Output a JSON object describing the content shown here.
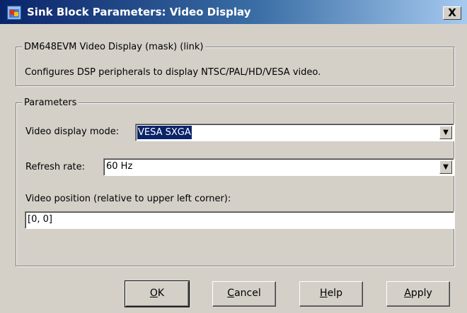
{
  "window": {
    "title": "Sink Block Parameters: Video Display",
    "close_label": "X"
  },
  "description_group": {
    "legend": "DM648EVM Video Display (mask) (link)",
    "text": "Configures DSP peripherals to display NTSC/PAL/HD/VESA video."
  },
  "parameters_group": {
    "legend": "Parameters",
    "video_display_mode": {
      "label": "Video display mode:",
      "value": "VESA SXGA"
    },
    "refresh_rate": {
      "label": "Refresh rate:",
      "value": "60 Hz"
    },
    "video_position": {
      "label": "Video position (relative to upper left corner):",
      "value": "[0, 0]"
    }
  },
  "buttons": {
    "ok": {
      "mnemonic": "O",
      "rest": "K"
    },
    "cancel": {
      "mnemonic": "C",
      "rest": "ancel"
    },
    "help": {
      "mnemonic": "H",
      "rest": "elp"
    },
    "apply": {
      "mnemonic": "A",
      "rest": "pply"
    }
  },
  "icons": {
    "window_icon": "simulink-block-icon",
    "close": "close-icon",
    "dropdown": "chevron-down-icon"
  },
  "colors": {
    "title_bar_start": "#0a246a",
    "title_bar_end": "#a6caf0",
    "dialog_face": "#d4d0c8",
    "selection": "#0a246a"
  }
}
